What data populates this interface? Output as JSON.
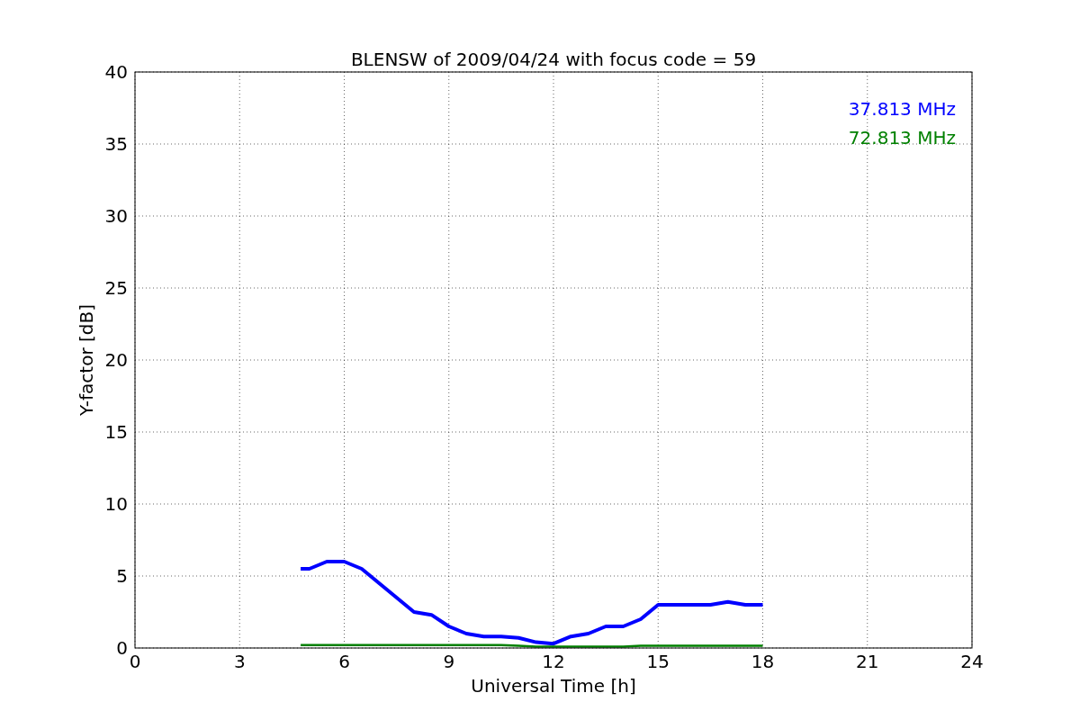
{
  "chart_data": {
    "type": "line",
    "title": "BLENSW of 2009/04/24 with focus code = 59",
    "xlabel": "Universal Time [h]",
    "ylabel": "Y-factor [dB]",
    "xlim": [
      0,
      24
    ],
    "ylim": [
      0,
      40
    ],
    "xticks": [
      0,
      3,
      6,
      9,
      12,
      15,
      18,
      21,
      24
    ],
    "yticks": [
      0,
      5,
      10,
      15,
      20,
      25,
      30,
      35,
      40
    ],
    "grid": true,
    "x": [
      4.75,
      5,
      5.5,
      6,
      6.5,
      7,
      7.5,
      8,
      8.5,
      9,
      9.5,
      10,
      10.5,
      11,
      11.5,
      12,
      12.5,
      13,
      13.5,
      14,
      14.5,
      15,
      15.5,
      16,
      16.5,
      17,
      17.5,
      18
    ],
    "series": [
      {
        "name": "37.813 MHz",
        "color": "#0000ff",
        "values": [
          5.5,
          5.5,
          6,
          6,
          5.5,
          4.5,
          3.5,
          2.5,
          2.3,
          1.5,
          1,
          0.8,
          0.8,
          0.7,
          0.4,
          0.3,
          0.8,
          1,
          1.5,
          1.5,
          2,
          3,
          3,
          3,
          3,
          3.2,
          3,
          3
        ]
      },
      {
        "name": "72.813 MHz",
        "color": "#008000",
        "values": [
          0.2,
          0.2,
          0.2,
          0.2,
          0.2,
          0.2,
          0.2,
          0.2,
          0.2,
          0.2,
          0.2,
          0.2,
          0.2,
          0.15,
          0.1,
          0.1,
          0.1,
          0.1,
          0.1,
          0.1,
          0.15,
          0.15,
          0.15,
          0.15,
          0.15,
          0.15,
          0.15,
          0.15
        ]
      }
    ]
  }
}
